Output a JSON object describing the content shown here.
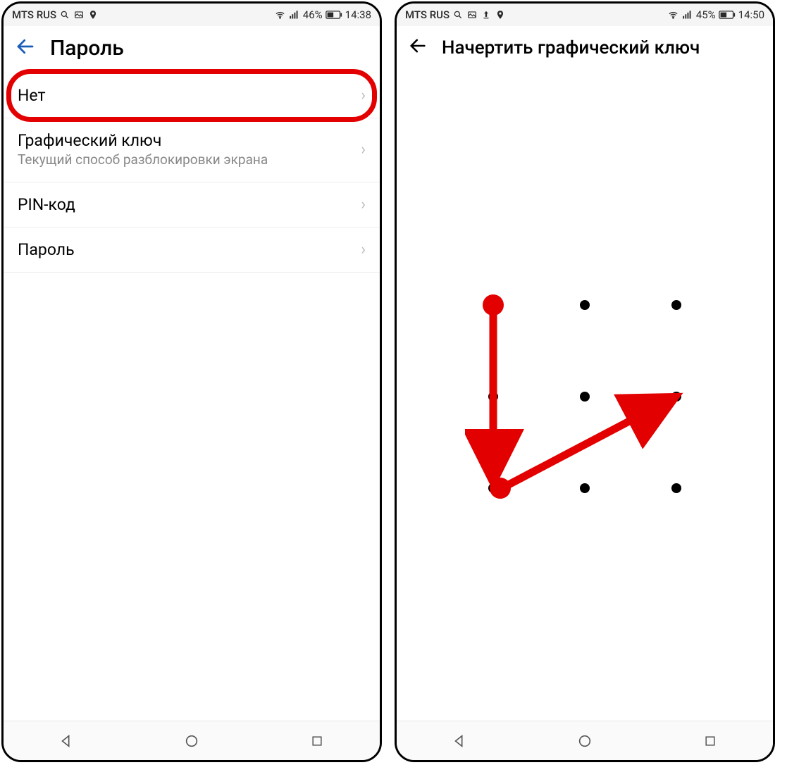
{
  "left": {
    "status": {
      "carrier": "MTS RUS",
      "battery_pct": "46%",
      "time": "14:38"
    },
    "header": {
      "title": "Пароль"
    },
    "options": [
      {
        "title": "Нет",
        "subtitle": "",
        "highlighted": true
      },
      {
        "title": "Графический ключ",
        "subtitle": "Текущий способ разблокировки экрана",
        "highlighted": false
      },
      {
        "title": "PIN-код",
        "subtitle": "",
        "highlighted": false
      },
      {
        "title": "Пароль",
        "subtitle": "",
        "highlighted": false
      }
    ]
  },
  "right": {
    "status": {
      "carrier": "MTS RUS",
      "battery_pct": "45%",
      "time": "14:50"
    },
    "header": {
      "title": "Начертить графический ключ"
    },
    "pattern": {
      "dots": 9,
      "path_nodes": [
        0,
        6,
        5
      ],
      "annotation_color": "#e30000"
    }
  }
}
